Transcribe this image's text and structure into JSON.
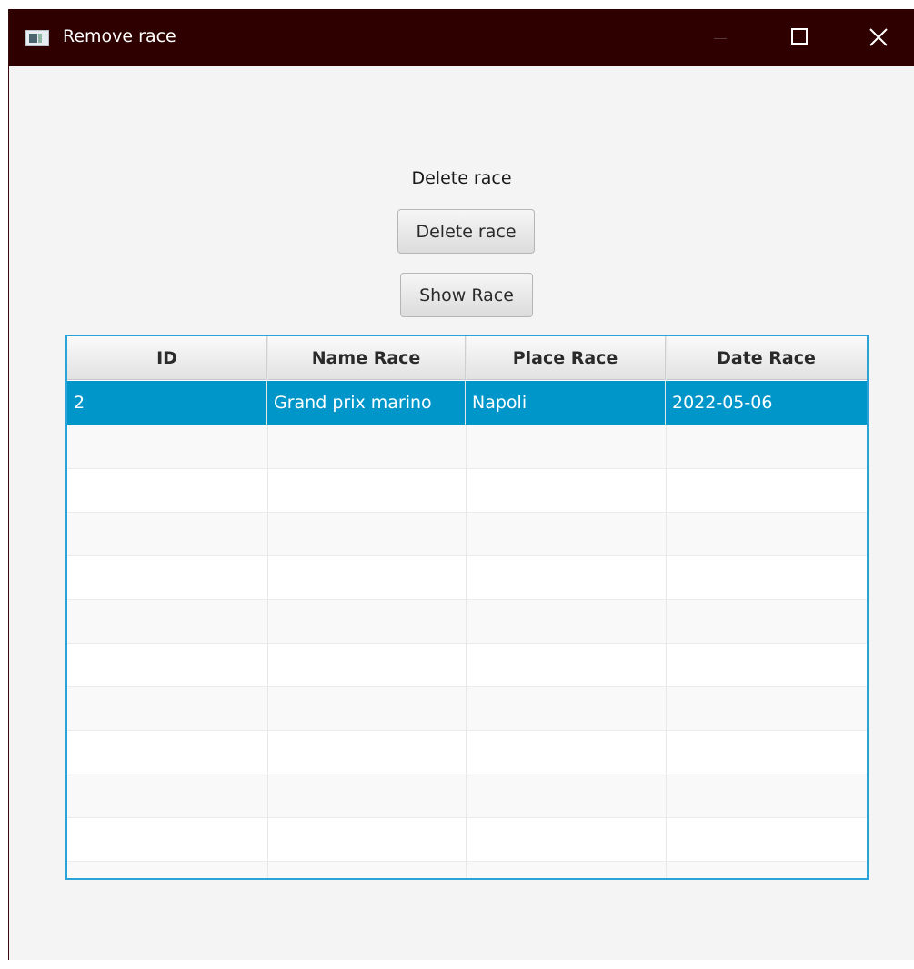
{
  "window": {
    "title": "Remove race"
  },
  "main": {
    "heading": "Delete race",
    "delete_button_label": "Delete race",
    "show_button_label": "Show Race"
  },
  "table": {
    "columns": [
      "ID",
      "Name Race",
      "Place Race",
      "Date Race"
    ],
    "rows": [
      [
        "2",
        "Grand prix marino",
        "Napoli",
        "2022-05-06"
      ]
    ]
  },
  "colors": {
    "titlebar": "#2e0000",
    "selection": "#0096c9",
    "table_border": "#2aa4d8",
    "background": "#f4f4f4"
  }
}
